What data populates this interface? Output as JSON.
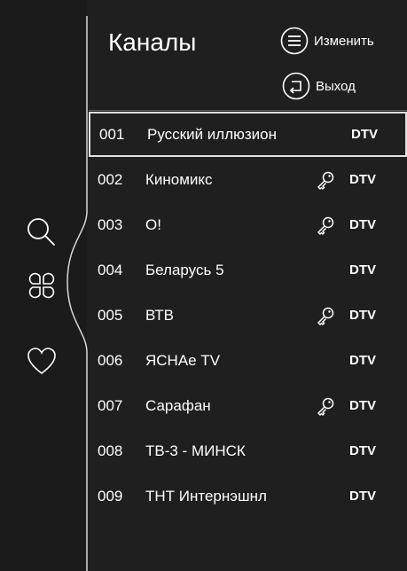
{
  "header": {
    "title": "Каналы",
    "edit_label": "Изменить",
    "exit_label": "Выход"
  },
  "sidebar": {
    "icons": [
      "search-icon",
      "categories-icon",
      "heart-icon"
    ]
  },
  "channels": [
    {
      "number": "001",
      "name": "Русский иллюзион",
      "locked": false,
      "type": "DTV",
      "selected": true
    },
    {
      "number": "002",
      "name": "Киномикс",
      "locked": true,
      "type": "DTV",
      "selected": false
    },
    {
      "number": "003",
      "name": "О!",
      "locked": true,
      "type": "DTV",
      "selected": false
    },
    {
      "number": "004",
      "name": "Беларусь 5",
      "locked": false,
      "type": "DTV",
      "selected": false
    },
    {
      "number": "005",
      "name": "ВТВ",
      "locked": true,
      "type": "DTV",
      "selected": false
    },
    {
      "number": "006",
      "name": "ЯСНАе TV",
      "locked": false,
      "type": "DTV",
      "selected": false
    },
    {
      "number": "007",
      "name": "Сарафан",
      "locked": true,
      "type": "DTV",
      "selected": false
    },
    {
      "number": "008",
      "name": "ТВ-3 - МИНСК",
      "locked": false,
      "type": "DTV",
      "selected": false
    },
    {
      "number": "009",
      "name": "ТНТ Интернэшнл",
      "locked": false,
      "type": "DTV",
      "selected": false
    }
  ],
  "colors": {
    "background": "#1f1f1f",
    "text": "#ffffff",
    "selection_border": "#e0e0e0"
  }
}
